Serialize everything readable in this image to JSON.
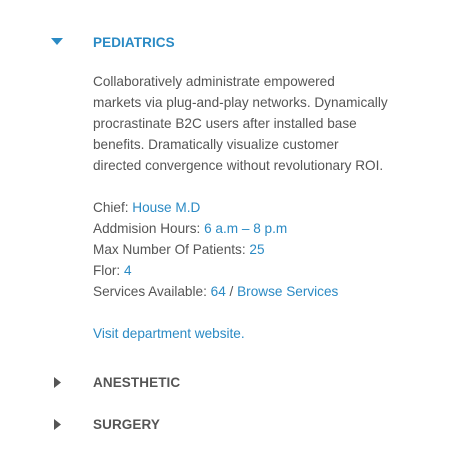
{
  "accordion": {
    "sections": [
      {
        "title": "PEDIATRICS",
        "state": "open",
        "description": [
          "Collaboratively administrate empowered",
          "markets via plug-and-play networks. Dynamically",
          "procrastinate B2C users after installed base",
          "benefits. Dramatically visualize customer",
          "directed convergence without revolutionary ROI."
        ],
        "info": {
          "chief_label": "Chief:",
          "chief_value": "House M.D",
          "hours_label": "Addmision Hours:",
          "hours_value": "6 a.m – 8 p.m",
          "max_label": "Max Number Of Patients:",
          "max_value": "25",
          "floor_label": "Flor:",
          "floor_value": "4",
          "services_label": "Services Available:",
          "services_value": "64",
          "services_separator": "/",
          "services_link": "Browse Services"
        },
        "website_link": "Visit department website."
      },
      {
        "title": "ANESTHETIC",
        "state": "closed"
      },
      {
        "title": "SURGERY",
        "state": "closed"
      }
    ]
  },
  "colors": {
    "accent": "#2a8ac4",
    "text": "#555555",
    "background": "#ffffff"
  },
  "icons": {
    "open": "caret-down-icon",
    "closed": "caret-right-icon"
  }
}
